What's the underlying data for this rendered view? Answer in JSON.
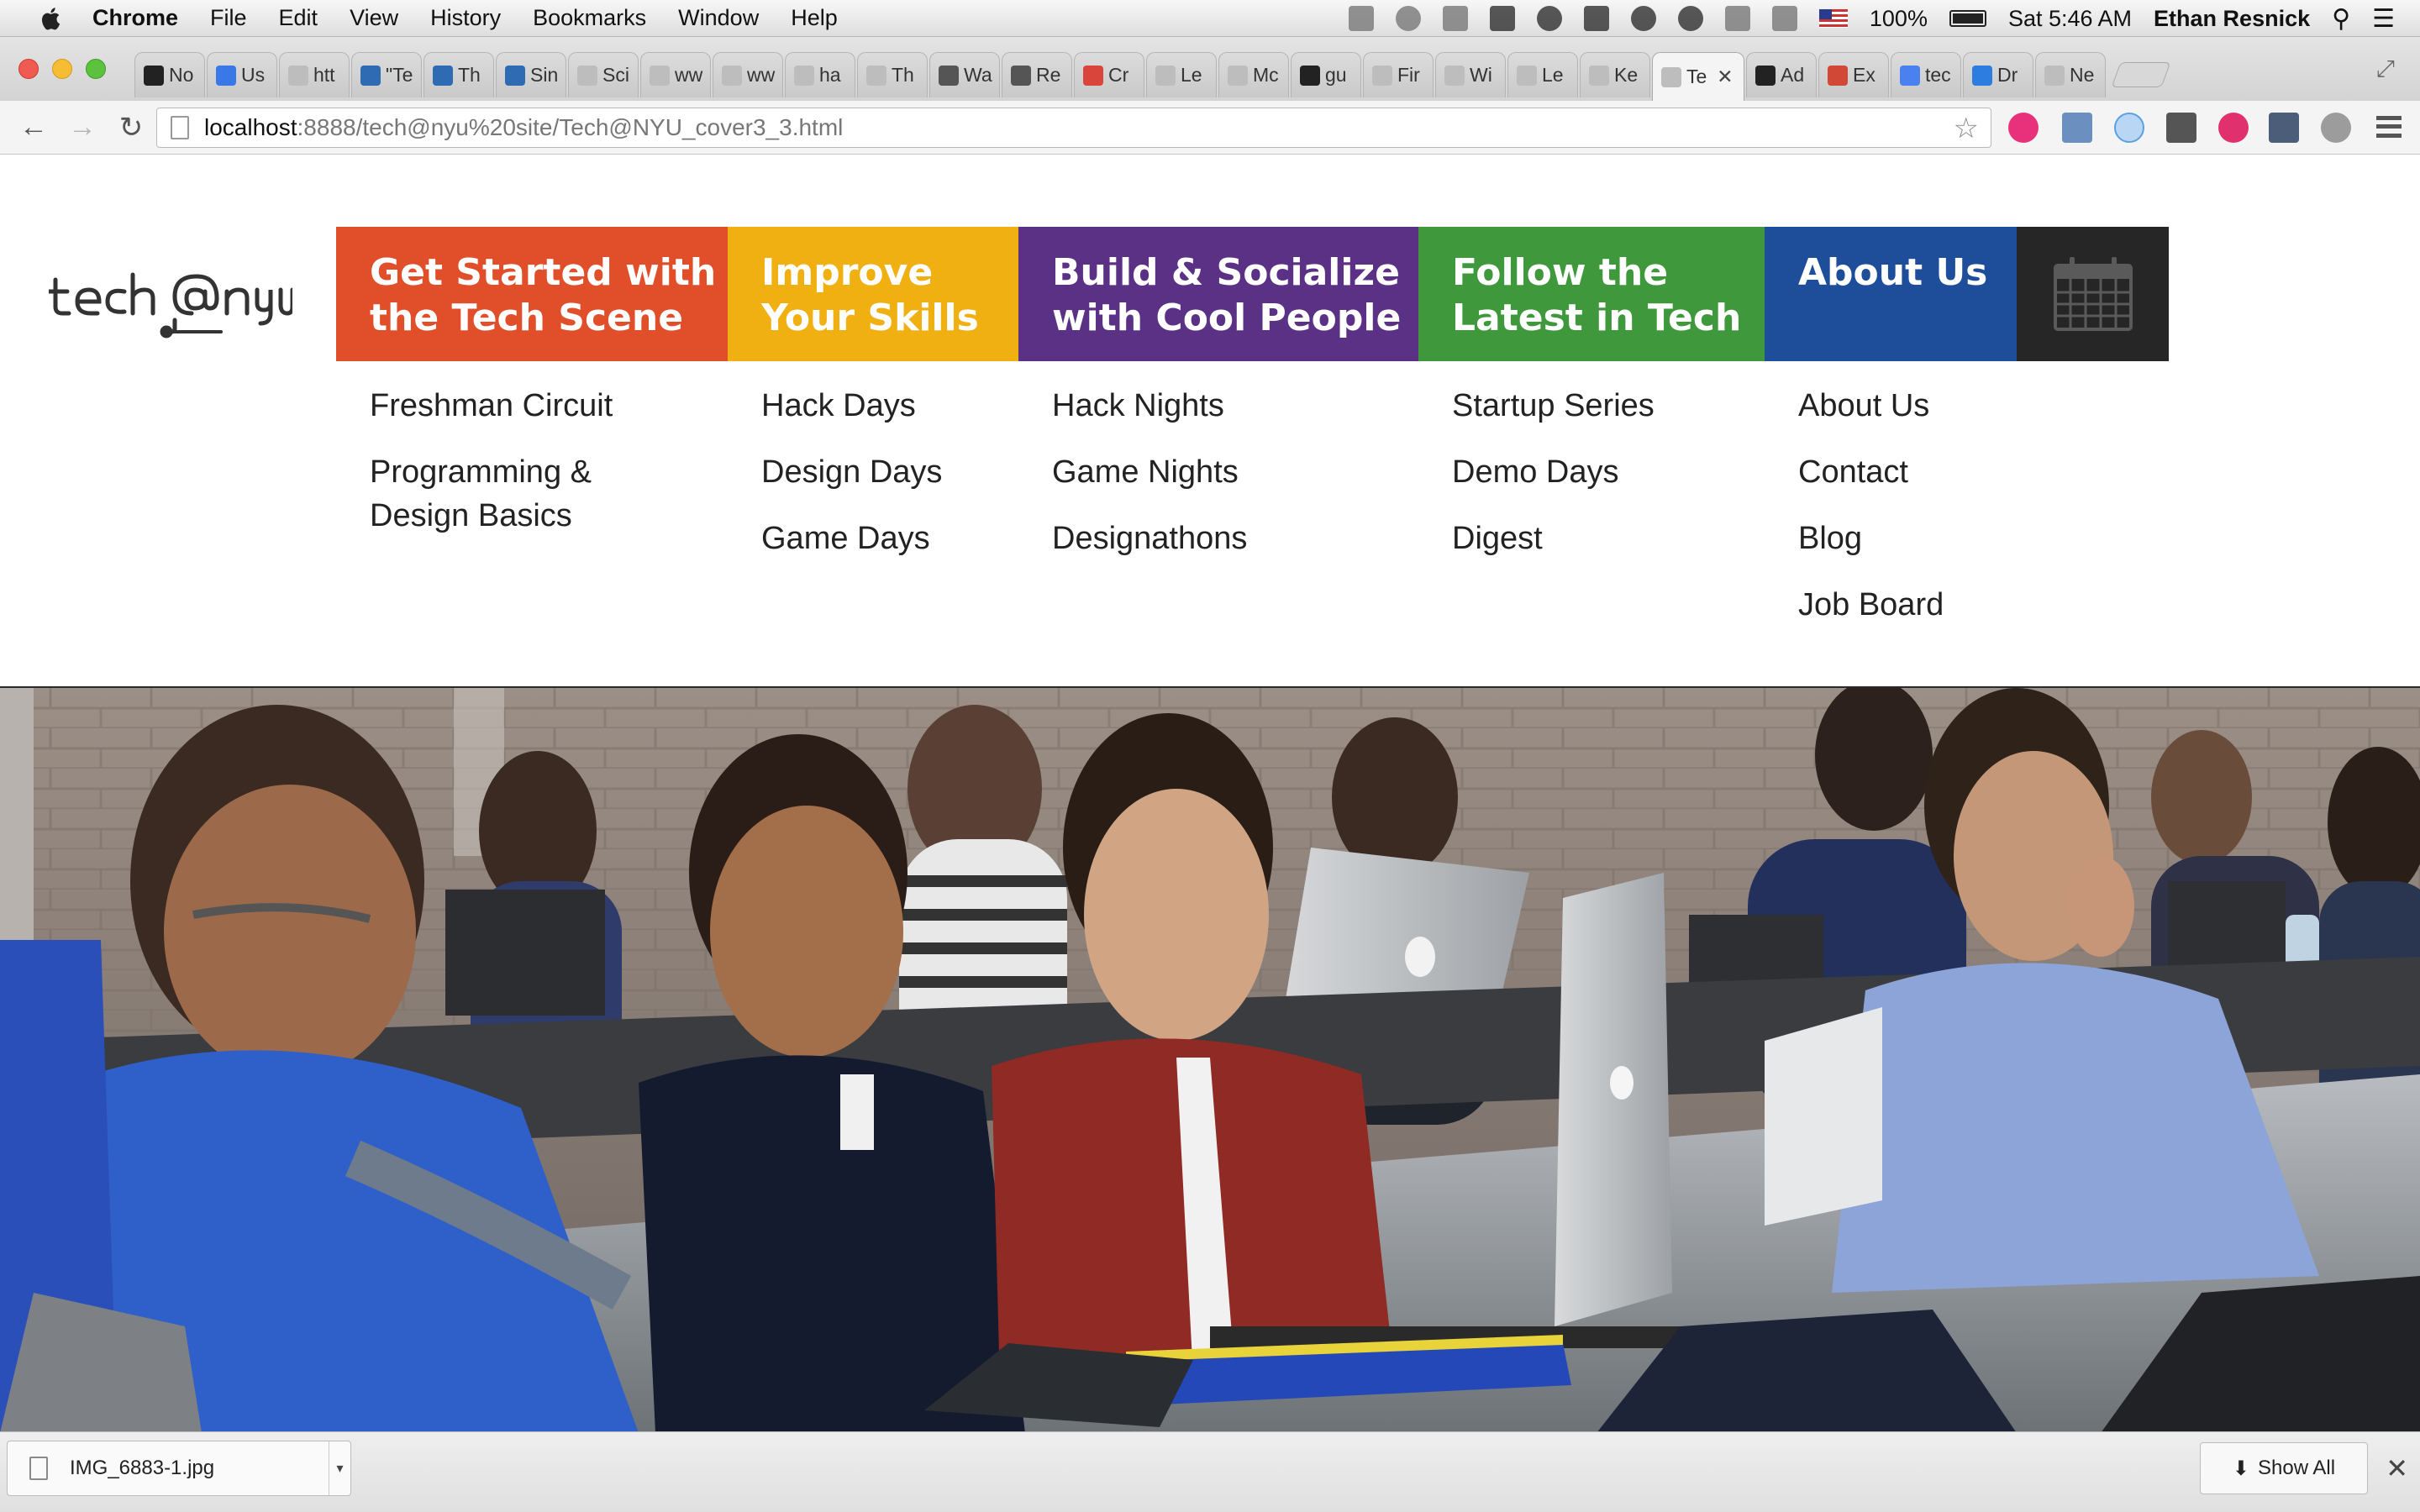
{
  "menubar": {
    "app": "Chrome",
    "items": [
      "File",
      "Edit",
      "View",
      "History",
      "Bookmarks",
      "Window",
      "Help"
    ],
    "battery": "100%",
    "clock": "Sat 5:46 AM",
    "user": "Ethan Resnick"
  },
  "tabs": [
    {
      "label": "No",
      "icon": "github-icon"
    },
    {
      "label": "Us",
      "icon": "google-icon"
    },
    {
      "label": "htt",
      "icon": "page-icon"
    },
    {
      "label": "\"Te",
      "icon": "s-icon"
    },
    {
      "label": "Th",
      "icon": "s-icon"
    },
    {
      "label": "Sin",
      "icon": "s-icon"
    },
    {
      "label": "Sci",
      "icon": "page-icon"
    },
    {
      "label": "ww",
      "icon": "page-icon"
    },
    {
      "label": "ww",
      "icon": "page-icon"
    },
    {
      "label": "ha",
      "icon": "page-icon"
    },
    {
      "label": "Th",
      "icon": "page-icon"
    },
    {
      "label": "Wa",
      "icon": "wikipedia-icon"
    },
    {
      "label": "Re",
      "icon": "wikipedia-icon"
    },
    {
      "label": "Cr",
      "icon": "chrome-icon"
    },
    {
      "label": "Le",
      "icon": "page-icon"
    },
    {
      "label": "Mc",
      "icon": "page-icon"
    },
    {
      "label": "gu",
      "icon": "github-icon"
    },
    {
      "label": "Fir",
      "icon": "page-icon"
    },
    {
      "label": "Wi",
      "icon": "page-icon"
    },
    {
      "label": "Le",
      "icon": "page-icon"
    },
    {
      "label": "Ke",
      "icon": "page-icon"
    },
    {
      "label": "Te",
      "icon": "page-icon",
      "active": true
    },
    {
      "label": "Ad",
      "icon": "github-icon"
    },
    {
      "label": "Ex",
      "icon": "gmail-icon"
    },
    {
      "label": "tec",
      "icon": "docs-icon"
    },
    {
      "label": "Dr",
      "icon": "dropbox-icon"
    },
    {
      "label": "Ne",
      "icon": "page-icon"
    }
  ],
  "omnibox": {
    "host": "localhost",
    "path": ":8888/tech@nyu%20site/Tech@NYU_cover3_3.html"
  },
  "site": {
    "logo_text": "tech@nyu",
    "nav": [
      {
        "line1": "Get Started with",
        "line2": "the Tech Scene",
        "color": "#e04e2a",
        "links": [
          "Freshman Circuit",
          "Programming &",
          "Design Basics"
        ]
      },
      {
        "line1": "Improve",
        "line2": "Your Skills",
        "color": "#f1b011",
        "links": [
          "Hack Days",
          "Design Days",
          "Game Days"
        ]
      },
      {
        "line1": "Build & Socialize",
        "line2": "with Cool People",
        "color": "#5a3184",
        "links": [
          "Hack Nights",
          "Game Nights",
          "Designathons"
        ]
      },
      {
        "line1": "Follow the",
        "line2": "Latest in Tech",
        "color": "#3f993c",
        "links": [
          "Startup Series",
          "Demo Days",
          "Digest"
        ]
      },
      {
        "line1": "About Us",
        "line2": "",
        "color": "#1e4e9a",
        "links": [
          "About Us",
          "Contact",
          "Blog",
          "Job Board"
        ]
      }
    ],
    "calendar_icon": "calendar-icon"
  },
  "download_shelf": {
    "file": "IMG_6883-1.jpg",
    "show_all": "Show All"
  }
}
